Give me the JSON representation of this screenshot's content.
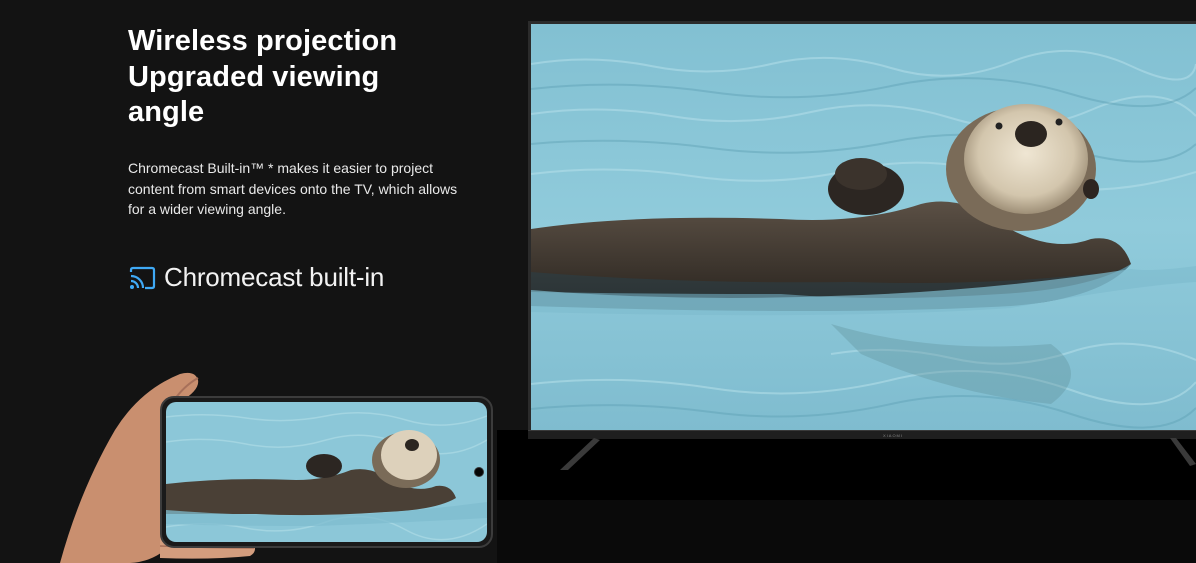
{
  "heading": {
    "line1": "Wireless projection",
    "line2": "Upgraded viewing",
    "line3": "angle"
  },
  "description": "Chromecast Built-in™ * makes it easier to project content from smart devices onto the TV, which allows for a wider viewing angle.",
  "chromecast": {
    "label": "Chromecast built-in",
    "icon": "cast-icon",
    "icon_color": "#3fa9f5"
  },
  "tv": {
    "brand": "XIAOMI"
  },
  "colors": {
    "background": "#131313",
    "water": "#8fc8d9",
    "otter_fur": "#4a4036",
    "otter_face": "#d8cdb8"
  }
}
